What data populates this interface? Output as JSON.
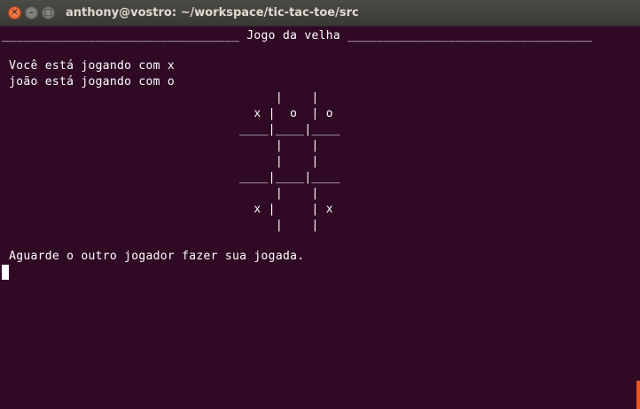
{
  "window": {
    "title": "anthony@vostro: ~/workspace/tic-tac-toe/src",
    "close_glyph": "✕",
    "min_glyph": "–",
    "max_glyph": "□"
  },
  "terminal": {
    "header": "_________________________________ Jogo da velha __________________________________",
    "player_line_1": " Você está jogando com x",
    "player_line_2": " joão está jogando com o",
    "board": [
      "                                      |    |",
      "                                   x |  o  | o",
      "                                 ____|____|____",
      "                                      |    |",
      "                                      |    |",
      "                                 ____|____|____",
      "                                      |    |",
      "                                   x |     | x",
      "                                      |    |"
    ],
    "board_cells": [
      "x",
      "o",
      "o",
      "",
      "",
      "",
      "x",
      "",
      "x"
    ],
    "status_message": " Aguarde o outro jogador fazer sua jogada."
  },
  "colors": {
    "background": "#300a24",
    "text": "#ffffff",
    "titlebar": "#3c3b37",
    "close_button": "#e95420"
  }
}
